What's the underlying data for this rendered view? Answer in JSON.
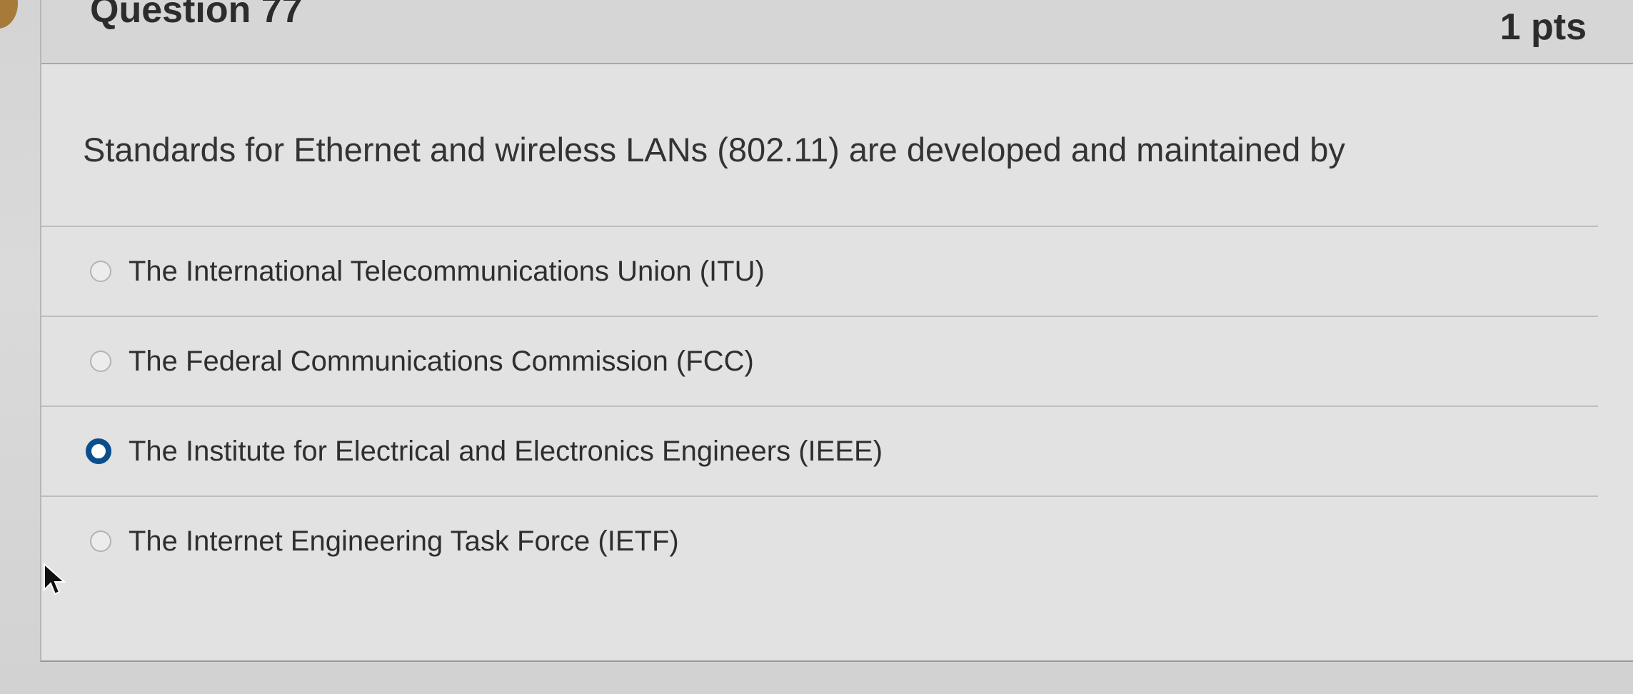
{
  "question": {
    "title": "Question 77",
    "points": "1 pts",
    "text": "Standards for Ethernet and wireless LANs (802.11) are developed and maintained by"
  },
  "answers": [
    {
      "label": "The International Telecommunications Union (ITU)",
      "selected": false
    },
    {
      "label": "The Federal Communications Commission (FCC)",
      "selected": false
    },
    {
      "label": "The Institute for Electrical and Electronics Engineers (IEEE)",
      "selected": true
    },
    {
      "label": "The Internet Engineering Task Force (IETF)",
      "selected": false
    }
  ],
  "colors": {
    "selected_radio": "#0a4f8c",
    "text": "#2e2e2e"
  },
  "icons": {
    "cursor": "mouse-pointer-icon",
    "radio_unselected": "radio-empty-icon",
    "radio_selected": "radio-selected-icon"
  }
}
